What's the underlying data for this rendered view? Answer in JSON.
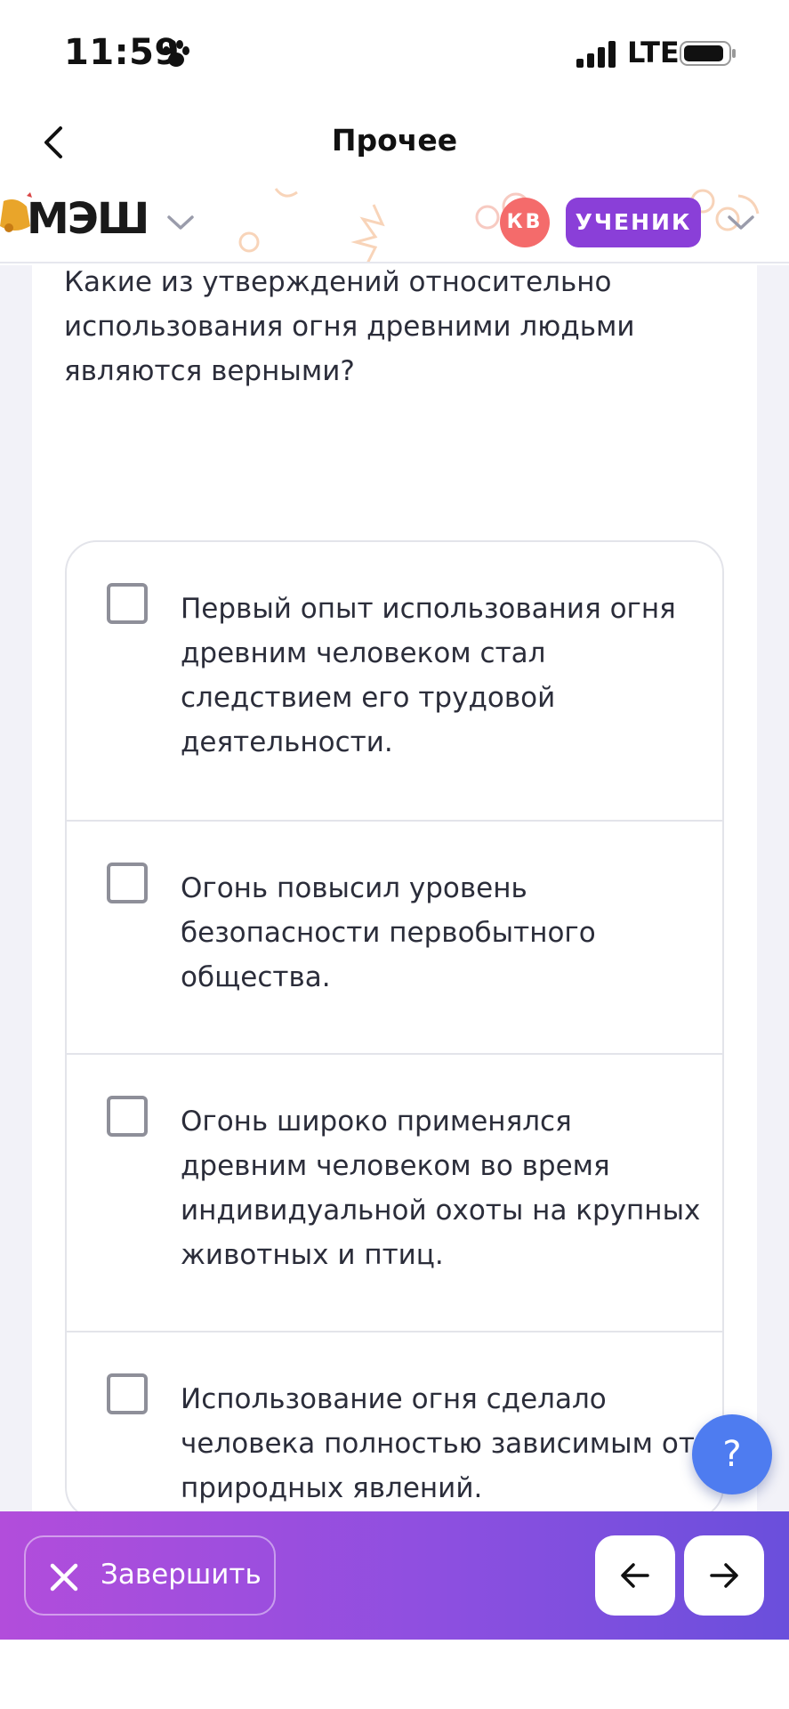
{
  "status_bar": {
    "time": "11:59",
    "network": "LTE",
    "icons": [
      "paw-icon",
      "signal-icon",
      "battery-icon"
    ]
  },
  "nav": {
    "title": "Прочее",
    "back_icon": "chevron-left-icon"
  },
  "app_header": {
    "logo": "МЭШ",
    "user_initials": "КВ",
    "role": "УЧЕНИК",
    "accent_color": "#8a3fd8",
    "avatar_color": "#f46b6b"
  },
  "question": {
    "text": "Какие из утверждений относительно использования огня древними людьми являются верными?",
    "options": [
      {
        "text": "Первый опыт использования огня древним человеком стал следствием его трудовой деятельности.",
        "checked": false
      },
      {
        "text": "Огонь повысил уровень безопасности первобытного общества.",
        "checked": false
      },
      {
        "text": "Огонь широко применялся древним человеком во время индивидуальной охоты на крупных животных и птиц.",
        "checked": false
      },
      {
        "text": "Использование огня сделало человека полностью зависимым от природных явлений.",
        "checked": false
      }
    ]
  },
  "help": {
    "label": "?",
    "color": "#4e7cf0"
  },
  "bottom_bar": {
    "finish_label": "Завершить",
    "finish_icon": "close-icon",
    "prev_icon": "arrow-left-icon",
    "next_icon": "arrow-right-icon",
    "gradient": [
      "#b24ddb",
      "#6a4fdc"
    ]
  }
}
